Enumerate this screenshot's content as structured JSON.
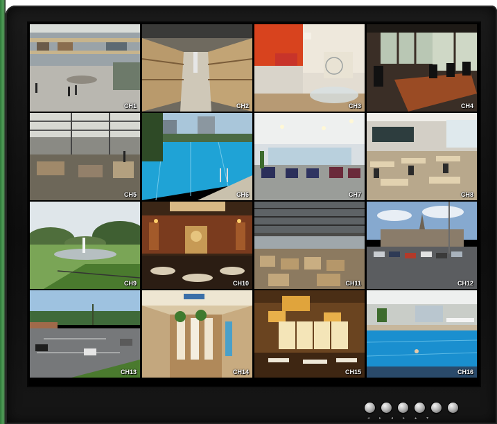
{
  "channels": [
    {
      "label": "CH1",
      "scene": "mall"
    },
    {
      "label": "CH2",
      "scene": "warehouse-aisle"
    },
    {
      "label": "CH3",
      "scene": "living-room"
    },
    {
      "label": "CH4",
      "scene": "conference-room"
    },
    {
      "label": "CH5",
      "scene": "factory-hall"
    },
    {
      "label": "CH6",
      "scene": "outdoor-pool"
    },
    {
      "label": "CH7",
      "scene": "lounge"
    },
    {
      "label": "CH8",
      "scene": "classroom"
    },
    {
      "label": "CH9",
      "scene": "park-fountain"
    },
    {
      "label": "CH10",
      "scene": "banquet-hall"
    },
    {
      "label": "CH11",
      "scene": "storage-warehouse"
    },
    {
      "label": "CH12",
      "scene": "parking-lot"
    },
    {
      "label": "CH13",
      "scene": "coastal-parking"
    },
    {
      "label": "CH14",
      "scene": "retail-shop"
    },
    {
      "label": "CH15",
      "scene": "restaurant"
    },
    {
      "label": "CH16",
      "scene": "indoor-pool"
    }
  ],
  "controls": {
    "buttons": [
      "button-1",
      "button-2",
      "button-3",
      "button-4",
      "button-5",
      "button-6"
    ],
    "arrow_glyphs": [
      "◂",
      "▸",
      "◂",
      "▸",
      "▴",
      "▾"
    ]
  },
  "colors": {
    "bezel": "#141414",
    "label": "#ffffff",
    "side_accent": "#54a05a"
  }
}
